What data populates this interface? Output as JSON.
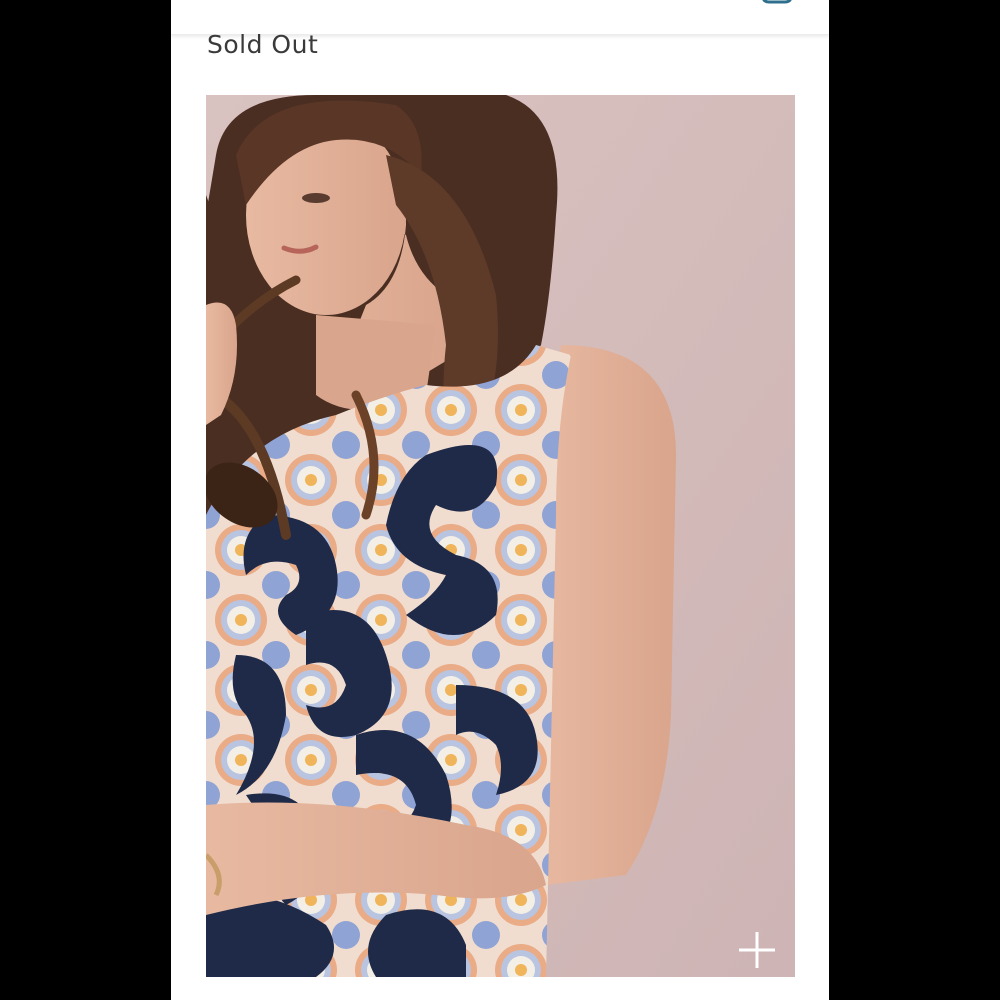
{
  "product": {
    "availability_status": "Sold Out",
    "image": {
      "description_icon": "product-photo",
      "background_color": "#d6bebe"
    }
  },
  "header": {
    "icons": [
      "search-icon",
      "shopping-bag-icon"
    ],
    "accent_color": "#2e6f8e"
  },
  "zoom": {
    "icon": "plus-icon"
  }
}
